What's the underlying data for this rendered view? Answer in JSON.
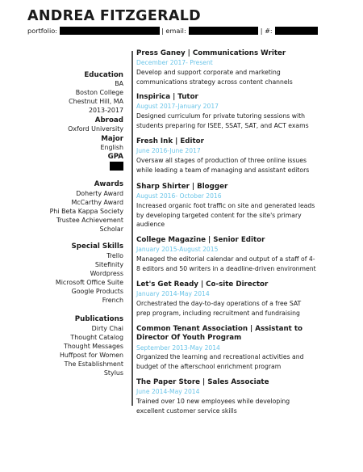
{
  "header": {
    "name": "ANDREA FITZGERALD",
    "portfolio_label": "portfolio:",
    "email_label": "| email:",
    "phone_label": "| #:"
  },
  "left": {
    "education": {
      "heading": "Education",
      "lines": [
        "BA",
        "Boston College",
        "Chestnut Hill, MA",
        "2013-2017"
      ],
      "abroad_heading": "Abroad",
      "abroad_lines": [
        "Oxford University"
      ],
      "major_heading": "Major",
      "major_lines": [
        "English"
      ],
      "gpa_heading": "GPA"
    },
    "awards": {
      "heading": "Awards",
      "items": [
        "Doherty Award",
        "McCarthy Award",
        "Phi Beta Kappa Society",
        "Trustee Achievement",
        "Scholar"
      ]
    },
    "skills": {
      "heading": "Special Skills",
      "items": [
        "Trello",
        "Sitefinity",
        "Wordpress",
        "Microsoft Office Suite",
        "Google Products",
        "French"
      ]
    },
    "publications": {
      "heading": "Publications",
      "items": [
        "Dirty Chai",
        "Thought Catalog",
        "Thought Messages",
        "Huffpost for Women",
        "The Establishment",
        "Stylus"
      ]
    }
  },
  "jobs": [
    {
      "title": "Press Ganey | Communications Writer",
      "dates": "December 2017- Present",
      "desc": [
        "Develop and support corporate and marketing",
        "communications strategy across content channels"
      ]
    },
    {
      "title": "Inspirica | Tutor",
      "dates": "August 2017-January 2017",
      "desc": [
        "Designed curriculum for private tutoring sessions with",
        "students preparing for ISEE, SSAT, SAT, and ACT exams"
      ]
    },
    {
      "title": "Fresh Ink | Editor",
      "dates": "June 2016-June 2017",
      "desc": [
        "Oversaw all stages of production of three online issues",
        "while leading a team of managing and assistant editors"
      ]
    },
    {
      "title": "Sharp Shirter | Blogger",
      "dates": "August 2016- October 2016",
      "desc": [
        "Increased organic foot traffic on site and generated leads",
        "by developing targeted content for the site's primary",
        "audience"
      ]
    },
    {
      "title": "College Magazine | Senior Editor",
      "dates": "January 2015-August 2015",
      "desc": [
        "Managed the editorial calendar and output of a staff of 4-",
        "8 editors and 50 writers in a deadline-driven environment"
      ]
    },
    {
      "title": "Let's Get Ready | Co-site Director",
      "dates": "January 2014-May 2014",
      "desc": [
        "Orchestrated the day-to-day operations of a free SAT",
        "prep program, including recruitment and fundraising"
      ]
    },
    {
      "title": "Common Tenant Association | Assistant to",
      "title2": "Director Of Youth Program",
      "dates": "September 2013-May 2014",
      "desc": [
        "Organized the learning and recreational activities and",
        "budget of the afterschool enrichment program"
      ]
    },
    {
      "title": "The Paper Store | Sales Associate",
      "dates": "June 2014-May 2014",
      "desc": [
        "Trained over 10 new employees while developing",
        "excellent customer service skills"
      ]
    }
  ]
}
